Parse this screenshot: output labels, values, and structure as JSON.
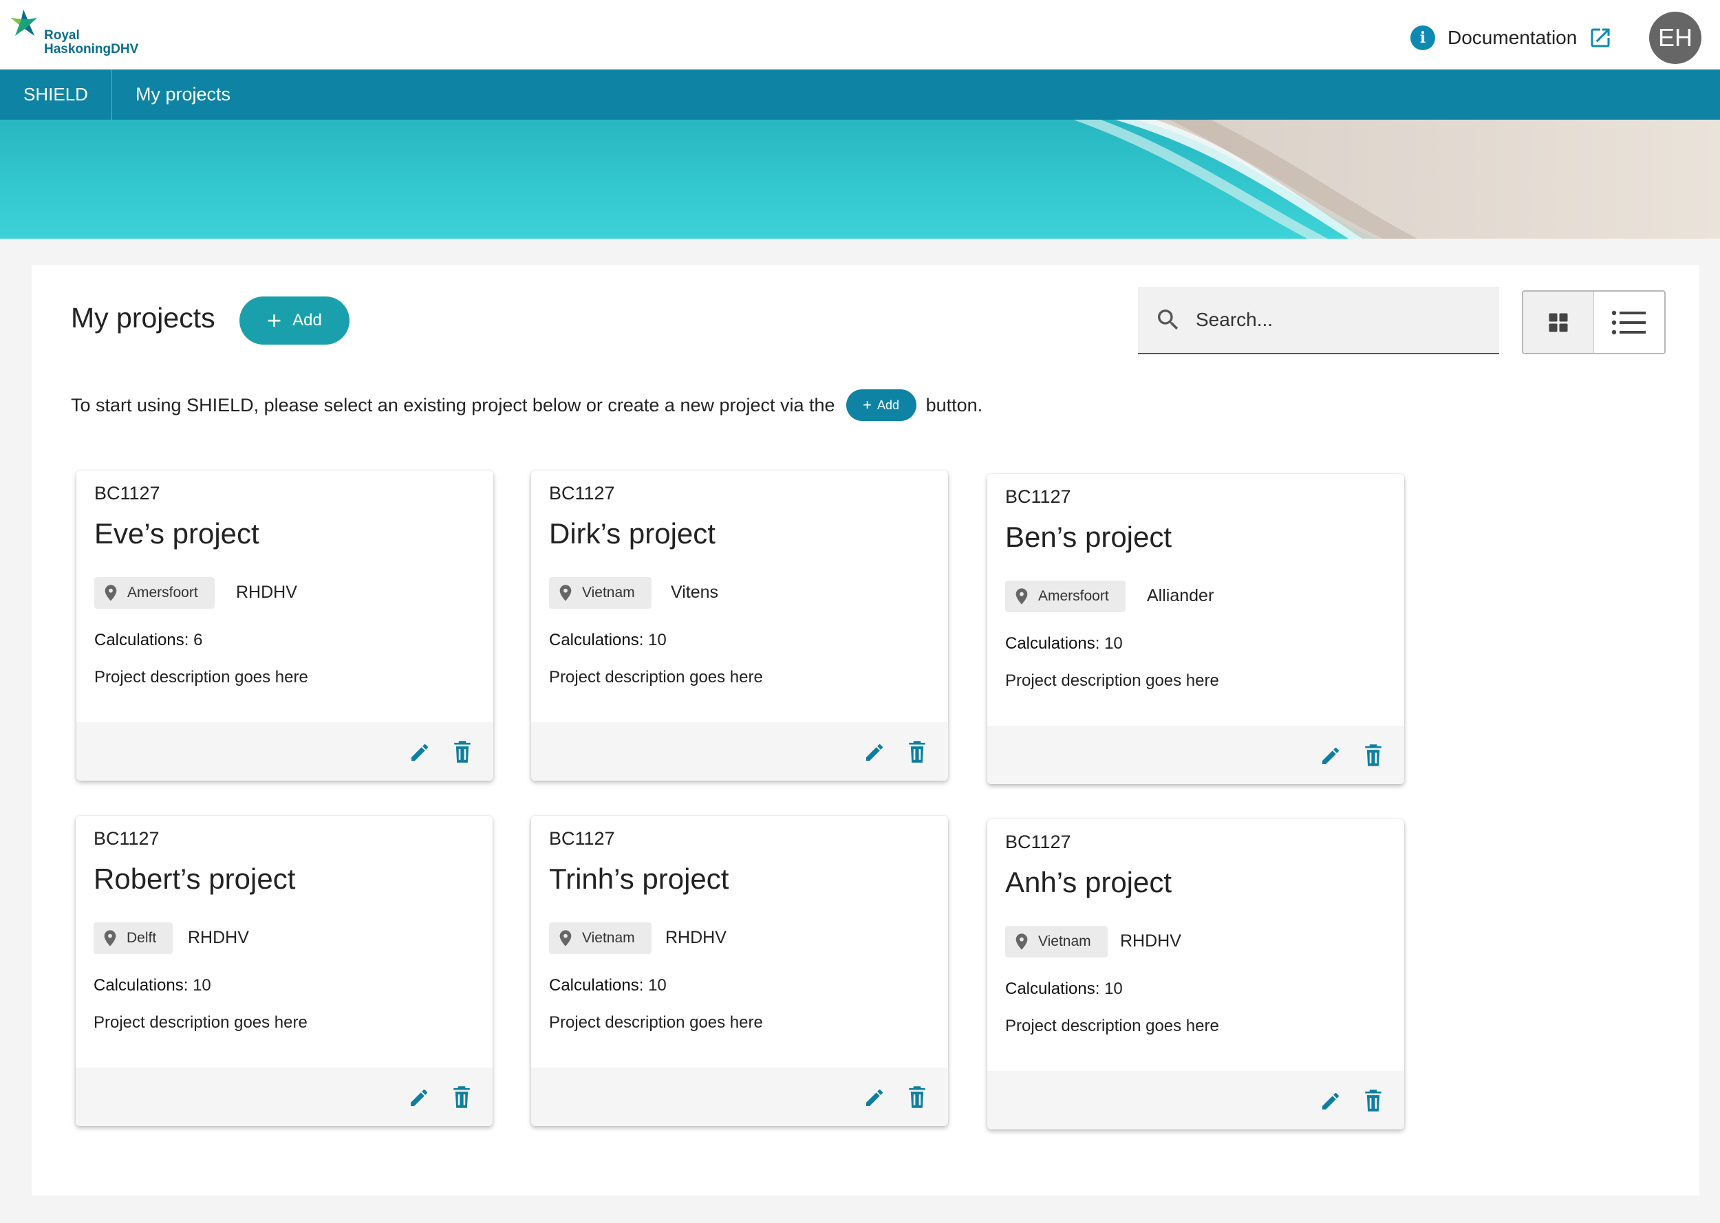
{
  "brand": {
    "logo_line1": "Royal",
    "logo_line2": "HaskoningDHV"
  },
  "header": {
    "documentation_label": "Documentation",
    "avatar_initials": "EH"
  },
  "nav": {
    "brand": "SHIELD",
    "current": "My projects"
  },
  "main": {
    "title": "My projects",
    "add_label": "Add",
    "search_placeholder": "Search...",
    "intro_before": "To start using SHIELD, please select an existing project below or create a new project via the",
    "intro_add_label": "Add",
    "intro_after": "button."
  },
  "projects": [
    {
      "code": "BC1127",
      "title": "Eve’s project",
      "location": "Amersfoort",
      "company": "RHDHV",
      "calculations_label": "Calculations:",
      "calculations": "6",
      "description": "Project description goes here"
    },
    {
      "code": "BC1127",
      "title": "Dirk’s project",
      "location": "Vietnam",
      "company": "Vitens",
      "calculations_label": "Calculations:",
      "calculations": "10",
      "description": "Project description goes here"
    },
    {
      "code": "BC1127",
      "title": "Ben’s project",
      "location": "Amersfoort",
      "company": "Alliander",
      "calculations_label": "Calculations:",
      "calculations": "10",
      "description": "Project description goes here"
    },
    {
      "code": "BC1127",
      "title": "Robert’s project",
      "location": "Delft",
      "company": "RHDHV",
      "calculations_label": "Calculations:",
      "calculations": "10",
      "description": "Project description goes here"
    },
    {
      "code": "BC1127",
      "title": "Trinh’s project",
      "location": "Vietnam",
      "company": "RHDHV",
      "calculations_label": "Calculations:",
      "calculations": "10",
      "description": "Project description goes here"
    },
    {
      "code": "BC1127",
      "title": "Anh’s project",
      "location": "Vietnam",
      "company": "RHDHV",
      "calculations_label": "Calculations:",
      "calculations": "10",
      "description": "Project description goes here"
    }
  ],
  "colors": {
    "primary": "#0e83a4",
    "accent_button": "#1aa0ac",
    "icon": "#0e7fa0"
  },
  "icons": {
    "info": "info-icon",
    "external": "external-link-icon",
    "search": "search-icon",
    "grid": "grid-view-icon",
    "list": "list-view-icon",
    "location": "location-pin-icon",
    "edit": "pencil-icon",
    "delete": "trash-icon"
  }
}
